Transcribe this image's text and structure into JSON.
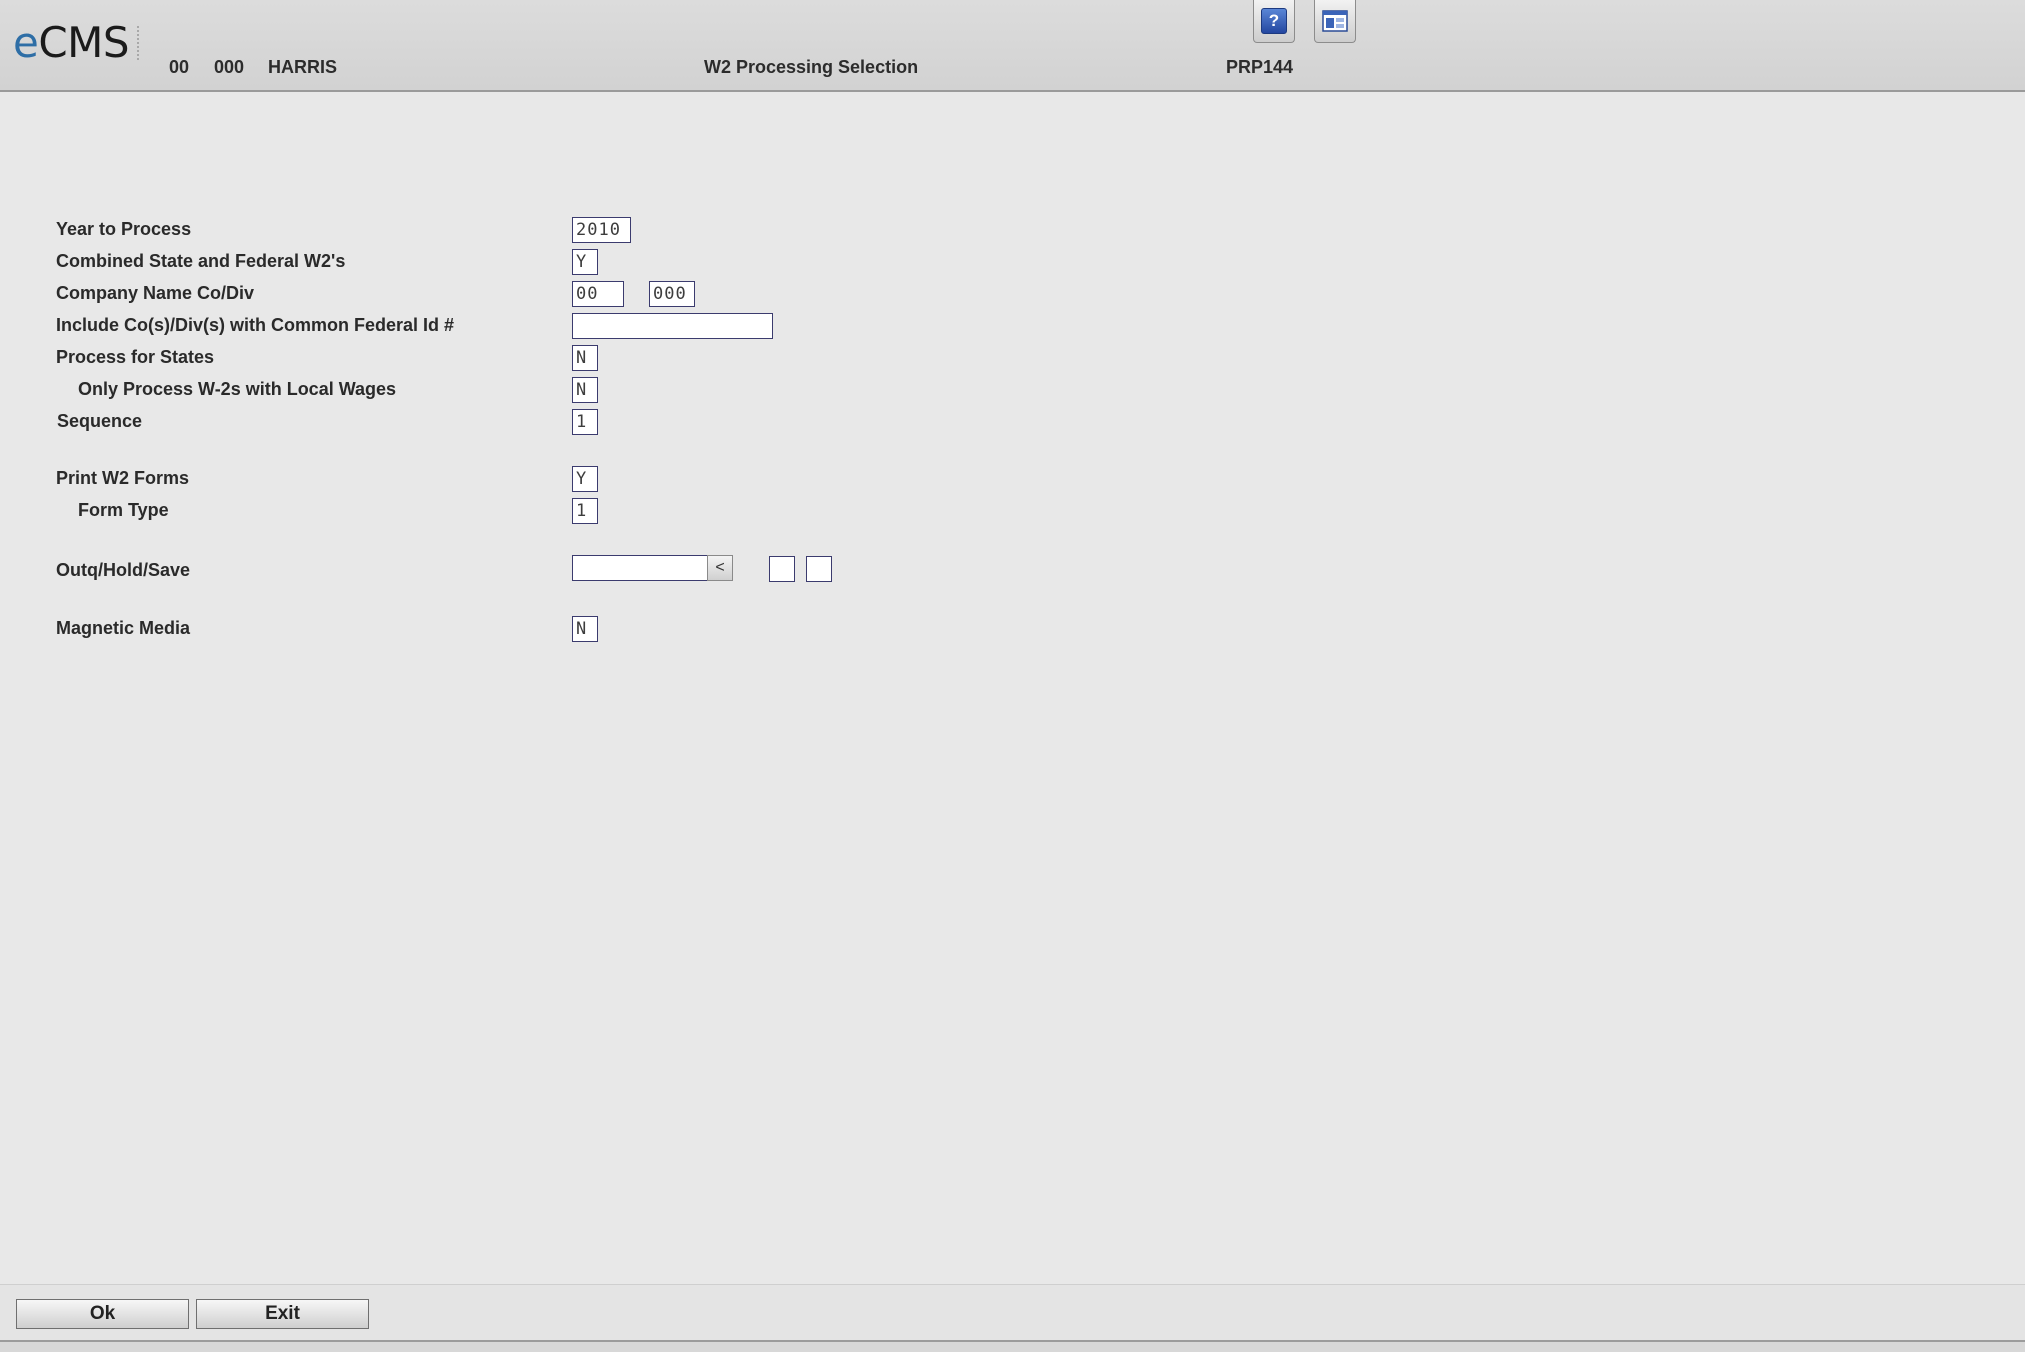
{
  "header": {
    "logo_e": "e",
    "logo_rest": "CMS",
    "company": "00",
    "division": "000",
    "user": "HARRIS",
    "title": "W2 Processing Selection",
    "program": "PRP144",
    "help_icon_glyph": "?",
    "help_icon": "help-icon",
    "window_icon": "window-icon"
  },
  "form": {
    "year_label": "Year to Process",
    "year_value": "2010",
    "combined_label": "Combined State and Federal W2's",
    "combined_value": "Y",
    "company_label": "Company Name  Co/Div",
    "company_value": "00",
    "division_value": "000",
    "include_label": "Include Co(s)/Div(s) with Common Federal Id #",
    "include_value": "",
    "states_label": "Process for States",
    "states_value": "N",
    "local_label": "Only Process W-2s with Local Wages",
    "local_value": "N",
    "sequence_label": "Sequence",
    "sequence_value": "1",
    "print_label": "Print W2 Forms",
    "print_value": "Y",
    "formtype_label": "Form Type",
    "formtype_value": "1",
    "outq_label": "Outq/Hold/Save",
    "outq_value": "",
    "outq_button_glyph": "<",
    "hold_value": "",
    "save_value": "",
    "magnetic_label": "Magnetic Media",
    "magnetic_value": "N"
  },
  "footer": {
    "ok_label": "Ok",
    "exit_label": "Exit"
  },
  "colors": {
    "background": "#e8e8e8",
    "field_border": "#3b3b6e",
    "logo_accent": "#2e6ea6"
  }
}
